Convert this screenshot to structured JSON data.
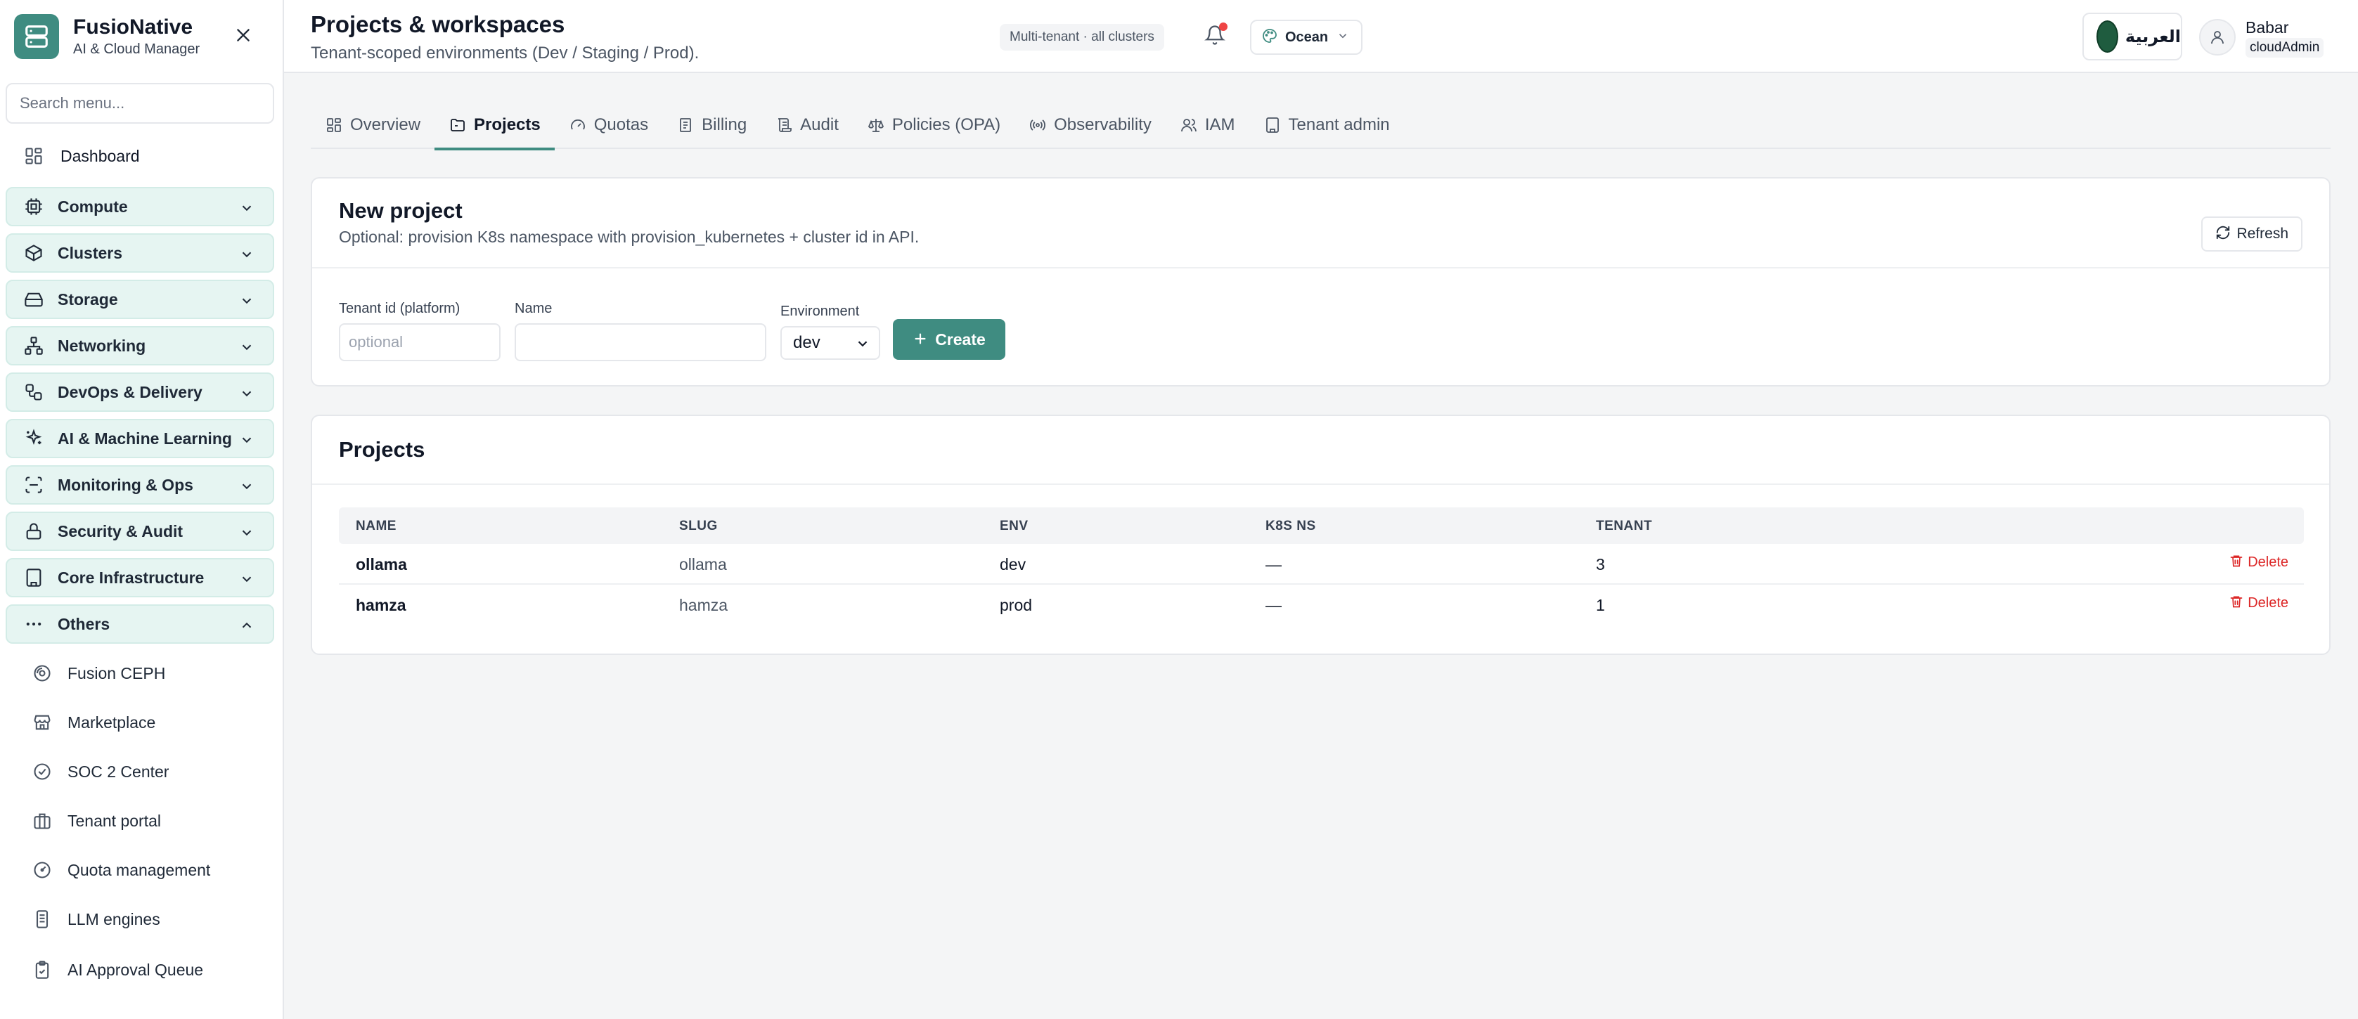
{
  "sidebar": {
    "brand_title": "FusioNative",
    "brand_subtitle": "AI & Cloud Manager",
    "search_placeholder": "Search menu...",
    "dashboard_label": "Dashboard",
    "groups": [
      {
        "label": "Compute",
        "icon": "cpu-icon"
      },
      {
        "label": "Clusters",
        "icon": "box-icon"
      },
      {
        "label": "Storage",
        "icon": "hard-drive-icon"
      },
      {
        "label": "Networking",
        "icon": "network-icon"
      },
      {
        "label": "DevOps & Delivery",
        "icon": "workflow-icon"
      },
      {
        "label": "AI & Machine Learning",
        "icon": "sparkles-icon"
      },
      {
        "label": "Monitoring & Ops",
        "icon": "scan-icon"
      },
      {
        "label": "Security & Audit",
        "icon": "lock-icon"
      },
      {
        "label": "Core Infrastructure",
        "icon": "building-icon"
      },
      {
        "label": "Others",
        "icon": "ellipsis-icon",
        "expanded": true
      }
    ],
    "others_items": [
      {
        "label": "Fusion CEPH",
        "icon": "disc-icon"
      },
      {
        "label": "Marketplace",
        "icon": "store-icon"
      },
      {
        "label": "SOC 2 Center",
        "icon": "check-circle-icon"
      },
      {
        "label": "Tenant portal",
        "icon": "briefcase-icon"
      },
      {
        "label": "Quota management",
        "icon": "gauge-icon"
      },
      {
        "label": "LLM engines",
        "icon": "server-icon"
      },
      {
        "label": "AI Approval Queue",
        "icon": "clipboard-check-icon"
      }
    ]
  },
  "header": {
    "title": "Projects & workspaces",
    "subtitle": "Tenant-scoped environments (Dev / Staging / Prod).",
    "tenant_chip": "Multi-tenant · all clusters",
    "theme_label": "Ocean",
    "language_label": "العربية",
    "user_name": "Babar",
    "user_role": "cloudAdmin"
  },
  "tabs": [
    {
      "label": "Overview",
      "icon": "layout-grid-icon",
      "active": false
    },
    {
      "label": "Projects",
      "icon": "folder-icon",
      "active": true
    },
    {
      "label": "Quotas",
      "icon": "gauge-icon",
      "active": false
    },
    {
      "label": "Billing",
      "icon": "receipt-icon",
      "active": false
    },
    {
      "label": "Audit",
      "icon": "scroll-icon",
      "active": false
    },
    {
      "label": "Policies (OPA)",
      "icon": "scale-icon",
      "active": false
    },
    {
      "label": "Observability",
      "icon": "radio-icon",
      "active": false
    },
    {
      "label": "IAM",
      "icon": "users-icon",
      "active": false
    },
    {
      "label": "Tenant admin",
      "icon": "building-icon",
      "active": false
    }
  ],
  "new_project": {
    "title": "New project",
    "description": "Optional: provision K8s namespace with provision_kubernetes + cluster id in API.",
    "refresh_label": "Refresh",
    "tenant_label": "Tenant id (platform)",
    "tenant_placeholder": "optional",
    "tenant_value": "",
    "name_label": "Name",
    "name_value": "",
    "env_label": "Environment",
    "env_value": "dev",
    "create_label": "Create"
  },
  "projects": {
    "title": "Projects",
    "columns": [
      "NAME",
      "SLUG",
      "ENV",
      "K8S NS",
      "TENANT"
    ],
    "delete_label": "Delete",
    "rows": [
      {
        "name": "ollama",
        "slug": "ollama",
        "env": "dev",
        "k8s_ns": "—",
        "tenant": "3"
      },
      {
        "name": "hamza",
        "slug": "hamza",
        "env": "prod",
        "k8s_ns": "—",
        "tenant": "1"
      }
    ]
  },
  "colors": {
    "accent": "#3f8c81",
    "nav_group_bg": "#e6f5f2",
    "danger": "#dc2626",
    "notification_dot": "#ef4444"
  }
}
